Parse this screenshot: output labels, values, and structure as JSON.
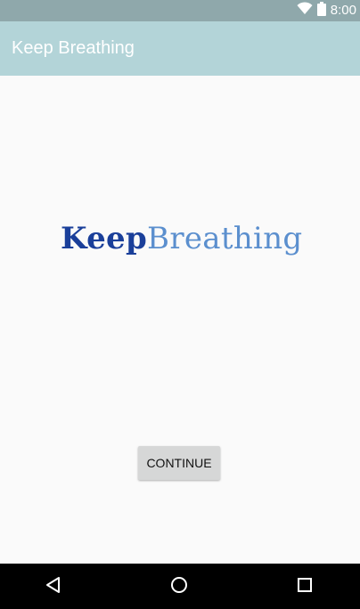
{
  "status_bar": {
    "time": "8:00",
    "icons": [
      "wifi-icon",
      "battery-icon"
    ]
  },
  "app_bar": {
    "title": "Keep Breathing"
  },
  "logo": {
    "part1": "Keep",
    "part2": "Breathing"
  },
  "main": {
    "continue_label": "CONTINUE"
  },
  "nav_bar": {
    "icons": [
      "back-icon",
      "home-icon",
      "recents-icon"
    ]
  },
  "colors": {
    "status_bar": "#8fa8ab",
    "app_bar": "#b3d4d8",
    "logo_keep": "#1a3f9a",
    "logo_breathing": "#5b8fce",
    "button": "#d6d7d7",
    "background": "#fafafa"
  }
}
